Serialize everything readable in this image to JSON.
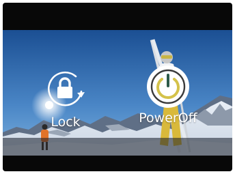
{
  "menu": {
    "lock": {
      "label": "Lock",
      "icon": "lock-rotate-icon"
    },
    "power": {
      "label": "PowerOff",
      "icon": "power-icon",
      "active": true
    }
  },
  "colors": {
    "frame": "#080808",
    "sky_top": "#1b4f93",
    "sky_bottom": "#6aa1d6",
    "label": "#ffffff",
    "power_accent": "#d4c24a"
  }
}
